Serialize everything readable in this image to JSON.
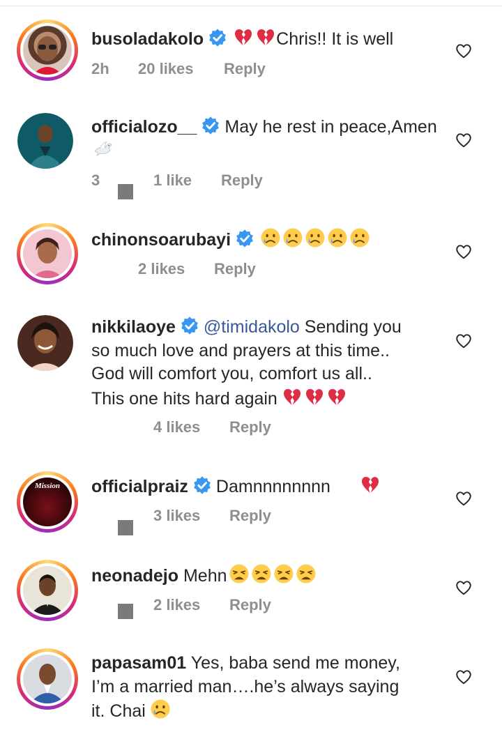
{
  "colors": {
    "accent_blue": "#3897f0",
    "meta_gray": "#8e8e8e",
    "text": "#262626",
    "mention": "#385898"
  },
  "comments": [
    {
      "username": "busoladakolo",
      "verified": true,
      "emojis": [
        "broken-heart",
        "broken-heart"
      ],
      "body": "Chris!! It is well",
      "time": "2h",
      "likes": "20 likes",
      "reply": "Reply"
    },
    {
      "username": "officialozo__",
      "verified": true,
      "body": "May he rest in peace,Amen",
      "emojis_after": [
        "dove"
      ],
      "time": "3",
      "likes": "1 like",
      "reply": "Reply"
    },
    {
      "username": "chinonsoarubayi",
      "verified": true,
      "emojis": [
        "crying-face",
        "crying-face",
        "crying-face",
        "crying-face",
        "crying-face"
      ],
      "body": "",
      "likes": "2 likes",
      "reply": "Reply"
    },
    {
      "username": "nikkilaoye",
      "verified": true,
      "mention": "@timidakolo",
      "body_lines": [
        "Sending you",
        "so much love and prayers at this time..",
        "God will comfort you, comfort us all..",
        "This one hits hard again"
      ],
      "emojis_after": [
        "broken-heart",
        "broken-heart",
        "broken-heart"
      ],
      "likes": "4 likes",
      "reply": "Reply"
    },
    {
      "username": "officialpraiz",
      "verified": true,
      "body": "Damnnnnnnnn",
      "emojis_after": [
        "broken-heart"
      ],
      "likes": "3 likes",
      "reply": "Reply",
      "avatar_text": "Mission"
    },
    {
      "username": "neonadejo",
      "verified": false,
      "body": "Mehn",
      "emojis_after": [
        "weary-face",
        "weary-face",
        "weary-face",
        "weary-face"
      ],
      "likes": "2 likes",
      "reply": "Reply"
    },
    {
      "username": "papasam01",
      "verified": false,
      "body_lines": [
        "Yes, baba send me money,",
        "I’m a married man….he’s always saying",
        "it. Chai"
      ],
      "emojis_after": [
        "crying-face"
      ]
    }
  ]
}
